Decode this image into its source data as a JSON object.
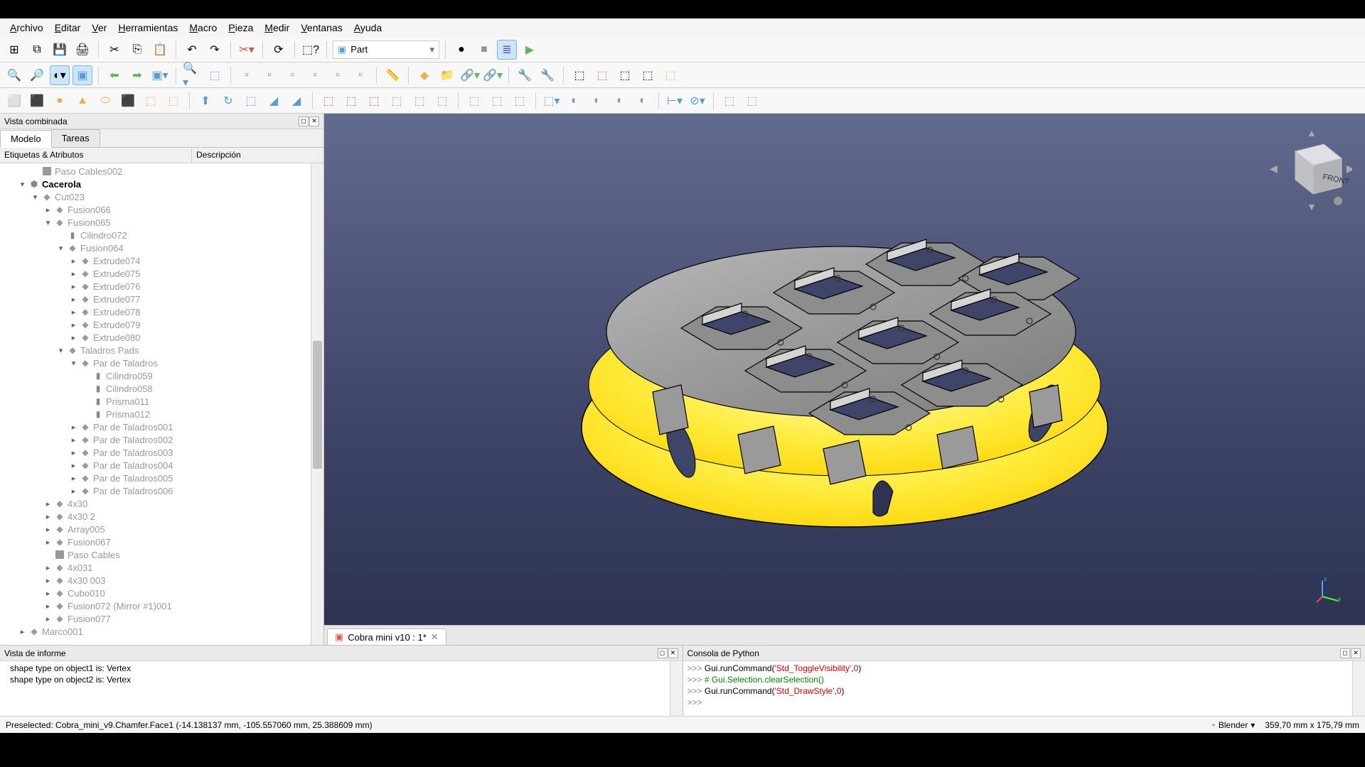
{
  "menubar": [
    "Archivo",
    "Editar",
    "Ver",
    "Herramientas",
    "Macro",
    "Pieza",
    "Medir",
    "Ventanas",
    "Ayuda"
  ],
  "workbench": "Part",
  "sidebar": {
    "title": "Vista combinada",
    "tabs": {
      "model": "Modelo",
      "tasks": "Tareas"
    },
    "columns": {
      "labels": "Etiquetas & Atributos",
      "desc": "Descripción"
    }
  },
  "tree": {
    "nodes": [
      {
        "d": 2,
        "t": "",
        "i": "box",
        "l": "Paso Cables002",
        "dim": true
      },
      {
        "d": 1,
        "t": "▾",
        "i": "group",
        "l": "Cacerola",
        "dim": false,
        "bold": true
      },
      {
        "d": 2,
        "t": "▾",
        "i": "part",
        "l": "Cut023",
        "dim": true
      },
      {
        "d": 3,
        "t": "▸",
        "i": "part",
        "l": "Fusion066",
        "dim": true
      },
      {
        "d": 3,
        "t": "▾",
        "i": "part",
        "l": "Fusion065",
        "dim": true
      },
      {
        "d": 4,
        "t": "",
        "i": "cyl",
        "l": "Cilindro072",
        "dim": true
      },
      {
        "d": 4,
        "t": "▾",
        "i": "part",
        "l": "Fusion064",
        "dim": true
      },
      {
        "d": 5,
        "t": "▸",
        "i": "part",
        "l": "Extrude074",
        "dim": true
      },
      {
        "d": 5,
        "t": "▸",
        "i": "part",
        "l": "Extrude075",
        "dim": true
      },
      {
        "d": 5,
        "t": "▸",
        "i": "part",
        "l": "Extrude076",
        "dim": true
      },
      {
        "d": 5,
        "t": "▸",
        "i": "part",
        "l": "Extrude077",
        "dim": true
      },
      {
        "d": 5,
        "t": "▸",
        "i": "part",
        "l": "Extrude078",
        "dim": true
      },
      {
        "d": 5,
        "t": "▸",
        "i": "part",
        "l": "Extrude079",
        "dim": true
      },
      {
        "d": 5,
        "t": "▸",
        "i": "part",
        "l": "Extrude080",
        "dim": true
      },
      {
        "d": 4,
        "t": "▾",
        "i": "part",
        "l": "Taladros Pads",
        "dim": true
      },
      {
        "d": 5,
        "t": "▾",
        "i": "part",
        "l": "Par de Taladros",
        "dim": true
      },
      {
        "d": 6,
        "t": "",
        "i": "cyl",
        "l": "Cilindro059",
        "dim": true
      },
      {
        "d": 6,
        "t": "",
        "i": "cyl",
        "l": "Cilindro058",
        "dim": true
      },
      {
        "d": 6,
        "t": "",
        "i": "cyl",
        "l": "Prisma011",
        "dim": true
      },
      {
        "d": 6,
        "t": "",
        "i": "cyl",
        "l": "Prisma012",
        "dim": true
      },
      {
        "d": 5,
        "t": "▸",
        "i": "part",
        "l": "Par de Taladros001",
        "dim": true
      },
      {
        "d": 5,
        "t": "▸",
        "i": "part",
        "l": "Par de Taladros002",
        "dim": true
      },
      {
        "d": 5,
        "t": "▸",
        "i": "part",
        "l": "Par de Taladros003",
        "dim": true
      },
      {
        "d": 5,
        "t": "▸",
        "i": "part",
        "l": "Par de Taladros004",
        "dim": true
      },
      {
        "d": 5,
        "t": "▸",
        "i": "part",
        "l": "Par de Taladros005",
        "dim": true
      },
      {
        "d": 5,
        "t": "▸",
        "i": "part",
        "l": "Par de Taladros006",
        "dim": true
      },
      {
        "d": 3,
        "t": "▸",
        "i": "part",
        "l": "4x30",
        "dim": true
      },
      {
        "d": 3,
        "t": "▸",
        "i": "part",
        "l": "4x30 2",
        "dim": true
      },
      {
        "d": 3,
        "t": "▸",
        "i": "part",
        "l": "Array005",
        "dim": true
      },
      {
        "d": 3,
        "t": "▸",
        "i": "part",
        "l": "Fusion067",
        "dim": true
      },
      {
        "d": 3,
        "t": "",
        "i": "box",
        "l": "Paso Cables",
        "dim": true
      },
      {
        "d": 3,
        "t": "▸",
        "i": "part",
        "l": "4x031",
        "dim": true
      },
      {
        "d": 3,
        "t": "▸",
        "i": "part",
        "l": "4x30 003",
        "dim": true
      },
      {
        "d": 3,
        "t": "▸",
        "i": "part",
        "l": "Cubo010",
        "dim": true
      },
      {
        "d": 3,
        "t": "▸",
        "i": "part",
        "l": "Fusion072 (Mirror #1)001",
        "dim": true
      },
      {
        "d": 3,
        "t": "▸",
        "i": "part",
        "l": "Fusion077",
        "dim": true
      },
      {
        "d": 1,
        "t": "▸",
        "i": "part",
        "l": "Marco001",
        "dim": true
      }
    ]
  },
  "docTab": "Cobra mini v10 : 1*",
  "report": {
    "title": "Vista de informe",
    "lines": [
      "shape type on object1 is: Vertex",
      "shape type on object2 is: Vertex"
    ]
  },
  "python": {
    "title": "Consola de Python",
    "lines": [
      {
        "prompt": ">>> ",
        "parts": [
          {
            "t": "Gui.runCommand(",
            "c": "cmd"
          },
          {
            "t": "'Std_ToggleVisibility'",
            "c": "str"
          },
          {
            "t": ",",
            "c": "cmd"
          },
          {
            "t": "0",
            "c": "num"
          },
          {
            "t": ")",
            "c": "cmd"
          }
        ]
      },
      {
        "prompt": ">>> ",
        "parts": [
          {
            "t": "# Gui.Selection.clearSelection()",
            "c": "comment"
          }
        ]
      },
      {
        "prompt": ">>> ",
        "parts": [
          {
            "t": "Gui.runCommand(",
            "c": "cmd"
          },
          {
            "t": "'Std_DrawStyle'",
            "c": "str"
          },
          {
            "t": ",",
            "c": "cmd"
          },
          {
            "t": "0",
            "c": "num"
          },
          {
            "t": ")",
            "c": "cmd"
          }
        ]
      },
      {
        "prompt": ">>> ",
        "parts": []
      }
    ]
  },
  "status": {
    "left": "Preselected: Cobra_mini_v9.Chamfer.Face1 (-14.138137 mm, -105.557060 mm, 25.388609 mm)",
    "blender": "Blender",
    "dims": "359,70 mm x 175,79 mm"
  },
  "navcube": "FRONT",
  "icons": {
    "row1": [
      "⊞",
      "⧉",
      "💾",
      "🖨",
      "|",
      "✂",
      "⎘",
      "📋",
      "|",
      "↶",
      "↷",
      "|",
      "✂",
      "|",
      "⟳",
      "|",
      "❓"
    ],
    "row2": [
      "🔍",
      "🔎",
      "⊗",
      "⬚",
      "|",
      "⬅",
      "➡",
      "⬚",
      "|",
      "🔍",
      "⬚",
      "|",
      "⬜",
      "⬜",
      "⬜",
      "⬜",
      "⬜",
      "⬜",
      "|",
      "📏",
      "|",
      "◆",
      "📁",
      "⬚",
      "⬚",
      "|",
      "🔧",
      "🔧",
      "|",
      "⬚",
      "⬚",
      "⬚",
      "⬚",
      "⬚"
    ],
    "row3": [
      "⬜",
      "⬛",
      "●",
      "▰",
      "⬭",
      "⬛",
      "⬚",
      "⬚",
      "|",
      "⚙",
      "⚙",
      "⬚",
      "◢",
      "◢",
      "|",
      "⬚",
      "⬚",
      "⬚",
      "⬚",
      "⬚",
      "|",
      "⬚",
      "⬚",
      "⬚",
      "|",
      "⬚",
      "⬚",
      "⬚",
      "⬚",
      "⬚",
      "|",
      "⬚",
      "⬚",
      "|",
      "⬚",
      "⬚"
    ]
  }
}
